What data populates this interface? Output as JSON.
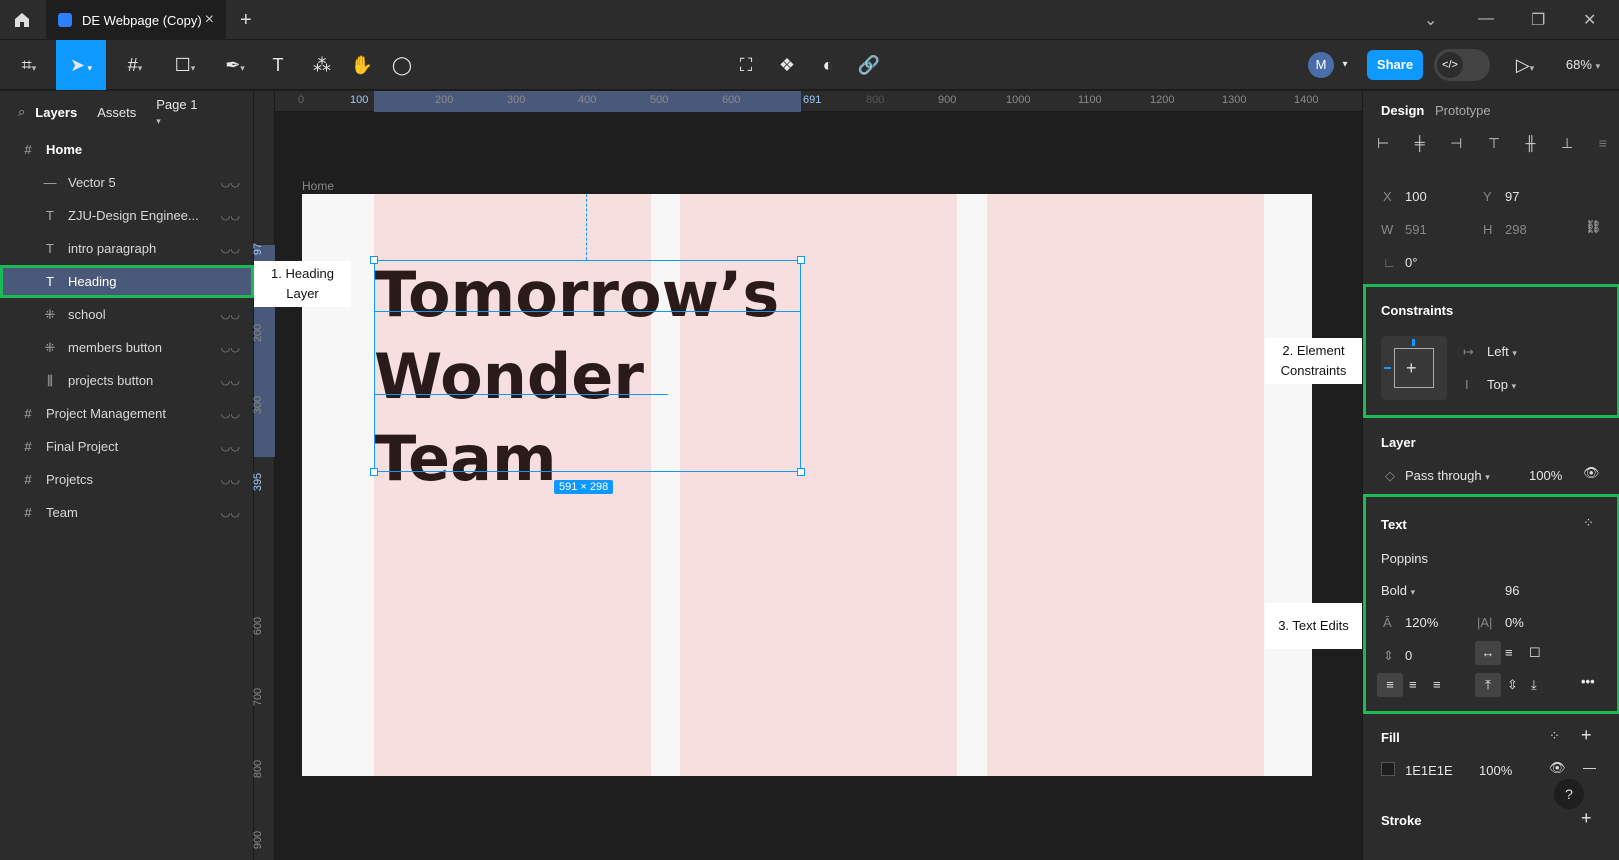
{
  "tab": {
    "title": "DE Webpage (Copy)"
  },
  "toolbar": {
    "avatar": "M",
    "share": "Share",
    "zoom": "68%"
  },
  "left_panel": {
    "tabs": [
      "Layers",
      "Assets"
    ],
    "page": "Page 1",
    "layers": [
      {
        "label": "Home",
        "icon": "frame-icon"
      },
      {
        "label": "Vector 5",
        "icon": "line-icon"
      },
      {
        "label": "ZJU-Design Enginee...",
        "icon": "text-icon"
      },
      {
        "label": "intro paragraph",
        "icon": "text-icon"
      },
      {
        "label": "Heading",
        "icon": "text-icon"
      },
      {
        "label": "school",
        "icon": "component-icon"
      },
      {
        "label": "members button",
        "icon": "component-icon"
      },
      {
        "label": "projects button",
        "icon": "component-icon"
      },
      {
        "label": "Project Management",
        "icon": "frame-icon"
      },
      {
        "label": "Final Project",
        "icon": "frame-icon"
      },
      {
        "label": "Projetcs",
        "icon": "frame-icon"
      },
      {
        "label": "Team",
        "icon": "frame-icon"
      }
    ]
  },
  "ruler": {
    "h_ticks": [
      "0",
      "100",
      "200",
      "300",
      "400",
      "500",
      "600",
      "691",
      "800",
      "900",
      "1000",
      "1100",
      "1200",
      "1300",
      "1400"
    ],
    "v_ticks": [
      "97",
      "200",
      "300",
      "395",
      "600",
      "700",
      "800",
      "900"
    ]
  },
  "canvas": {
    "frame_label": "Home",
    "heading_lines": [
      "Tomorrow’s",
      "Wonder",
      "Team"
    ],
    "size_badge": "591 × 298"
  },
  "callouts": {
    "c1": "1. Heading Layer",
    "c2": "2. Element Constraints",
    "c3": "3. Text Edits"
  },
  "right_panel": {
    "tabs": [
      "Design",
      "Prototype"
    ],
    "x_label": "X",
    "x": "100",
    "y_label": "Y",
    "y": "97",
    "w_label": "W",
    "w": "591",
    "h_label": "H",
    "h": "298",
    "rotation": "0°",
    "constraints_title": "Constraints",
    "constraint_h": "Left",
    "constraint_v": "Top",
    "layer_title": "Layer",
    "blend": "Pass through",
    "layer_opacity": "100%",
    "text_title": "Text",
    "font": "Poppins",
    "weight": "Bold",
    "size": "96",
    "line_height": "120%",
    "letter_spacing": "0%",
    "paragraph_spacing": "0",
    "fill_title": "Fill",
    "fill_hex": "1E1E1E",
    "fill_opacity": "100%",
    "stroke_title": "Stroke"
  },
  "colors": {
    "accent": "#0d99ff",
    "highlight": "#1db954",
    "column": "#f8dfdf",
    "heading": "#2b1a1a"
  }
}
